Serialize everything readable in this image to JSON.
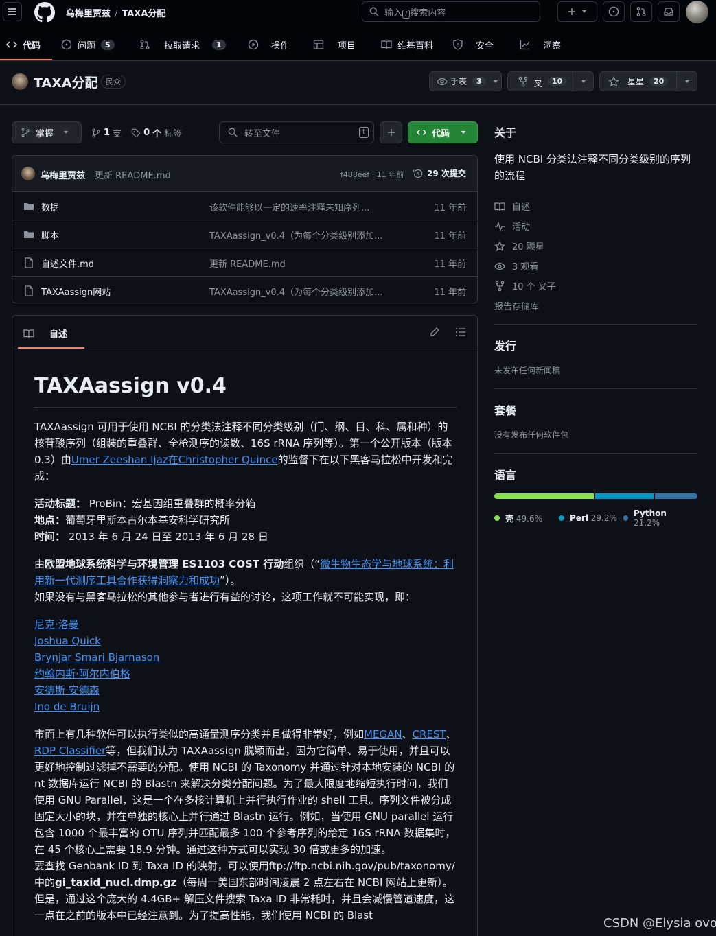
{
  "header": {
    "owner": "乌梅里贾兹",
    "repo": "TAXA分配",
    "search_placeholder": "输入",
    "search_key": "/",
    "search_suffix": "搜索内容"
  },
  "nav": {
    "code": "代码",
    "issues": "问题",
    "issues_count": "5",
    "pulls": "拉取请求",
    "pulls_count": "1",
    "actions": "操作",
    "projects": "项目",
    "wiki": "维基百科",
    "security": "安全",
    "insights": "洞察"
  },
  "repo": {
    "name": "TAXA分配",
    "visibility": "民众",
    "watch_label": "手表",
    "watch_count": "3",
    "fork_label": "叉",
    "fork_count": "10",
    "star_label": "星星",
    "star_count": "20"
  },
  "controls": {
    "branch": "掌握",
    "branches_count": "1",
    "branches_label": "支",
    "tags_count": "0",
    "tags_label": "个",
    "tags_suffix": "标签",
    "goto_file": "转至文件",
    "goto_key": "t",
    "code_button": "代码"
  },
  "commit": {
    "author": "乌梅里贾兹",
    "message": "更新 README.md",
    "sha_age": "f488eef · 11 年前",
    "history": "29 次提交"
  },
  "files": [
    {
      "type": "folder",
      "name": "数据",
      "message": "该软件能够以一定的速率注释未知序列...",
      "age": "11 年前"
    },
    {
      "type": "folder",
      "name": "脚本",
      "message": "TAXAassign_v0.4（为每个分类级别添加...",
      "age": "11 年前"
    },
    {
      "type": "file",
      "name": "自述文件.md",
      "message": "更新 README.md",
      "age": "11 年前"
    },
    {
      "type": "file",
      "name": "TAXAassign网站",
      "message": "TAXAassign_v0.4（为每个分类级别添加...",
      "age": "11 年前"
    }
  ],
  "readme": {
    "tab": "自述",
    "title": "TAXAassign v0.4",
    "p1_a": "TAXAassign 可用于使用 NCBI 的分类法注释不同分类级别（门、纲、目、科、属和种）的核苷酸序列（组装的重叠群、全枪测序的读数、16S rRNA 序列等）。第一个公开版本（版本 0.3）由",
    "p1_link": "Umer Zeeshan Ijaz在Christopher Quince",
    "p1_b": "的监督下在以下黑客马拉松中开发和完成：",
    "event_label": "活动标题：",
    "event_value": "ProBin：宏基因组重叠群的概率分箱",
    "place_label": "地点：",
    "place_value": "葡萄牙里斯本古尔本基安科学研究所",
    "time_label": "时间：",
    "time_value": "2013 年 6 月 24 日至 2013 年 6 月 28 日",
    "org_a": "由",
    "org_bold": "欧盟地球系统科学与环境管理 ES1103 COST 行动",
    "org_b": "组织（“",
    "org_link": "微生物生态学与地球系统：利用新一代测序工具合作获得洞察力和成功",
    "org_c": "”）。",
    "org_d": "如果没有与黑客马拉松的其他参与者进行有益的讨论，这项工作就不可能实现，即：",
    "people": [
      "尼克·洛曼",
      "Joshua Quick",
      "Brynjar Smari Bjarnason",
      "约翰内斯·阿尔内伯格",
      "安德斯·安德森",
      "Ino de Bruijn"
    ],
    "p3_a": "市面上有几种软件可以执行类似的高通量测序分类并且做得非常好，例如",
    "p3_l1": "MEGAN",
    "p3_s1": "、",
    "p3_l2": "CREST",
    "p3_s2": "、",
    "p3_l3": "RDP Classifier",
    "p3_b": "等，但我们认为 TAXAassign 脱颖而出，因为它简单、易于使用，并且可以更好地控制过滤掉不需要的分配。使用 NCBI 的 Taxonomy 并通过针对本地安装的 NCBI 的 nt 数据库运行 NCBI 的 Blastn 来解决分类分配问题。为了最大限度地缩短执行时间，我们使用 GNU Parallel，这是一个在多核计算机上并行执行作业的 shell 工具。序列文件被分成固定大小的块，并在单独的核心上并行通过 Blastn 运行。例如，当使用 GNU parallel 运行包含 1000 个最丰富的 OTU 序列并匹配最多 100 个参考序列的给定 16S rRNA 数据集时，在 45 个核心上需要 18.9 分钟。通过这种方式可以实现 30 倍或更多的加速。",
    "p4_a": "要查找 Genbank ID 到 Taxa ID 的映射，可以使用ftp://ftp.ncbi.nih.gov/pub/taxonomy/中的",
    "p4_bold": "gi_taxid_nucl.dmp.gz",
    "p4_b": "（每周一美国东部时间凌晨 2 点左右在 NCBI 网站上更新）。但是，通过这个庞大的 4.4GB+ 解压文件搜索 Taxa ID 非常耗时，并且会减慢管道速度，这一点在之前的版本中已经注意到。为了提高性能，我们使用 NCBI 的 Blast"
  },
  "sidebar": {
    "about_title": "关于",
    "description": "使用 NCBI 分类法注释不同分类级别的序列的流程",
    "readme": "自述",
    "activity": "活动",
    "stars": "20 颗星",
    "watching": "3 观看",
    "forks": "10 个 叉子",
    "report": "报告存储库",
    "releases_title": "发行",
    "releases_empty": "未发布任何新闻稿",
    "packages_title": "套餐",
    "packages_empty": "没有发布任何软件包",
    "languages_title": "语言",
    "languages": [
      {
        "name": "壳",
        "percent": "49.6%",
        "value": 49.6,
        "color": "#89e051"
      },
      {
        "name": "Perl",
        "percent": "29.2%",
        "value": 29.2,
        "color": "#0298c3"
      },
      {
        "name": "Python",
        "percent": "21.2%",
        "value": 21.2,
        "color": "#3572a5"
      }
    ]
  },
  "watermark": "CSDN @Elysia ovo"
}
